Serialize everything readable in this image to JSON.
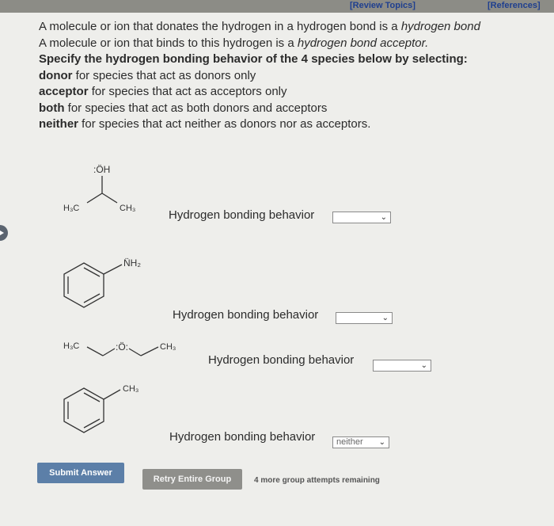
{
  "header": {
    "review_topics": "[Review Topics]",
    "references": "[References]"
  },
  "intro": {
    "line1_start": "A molecule or ion that donates the hydrogen in a hydrogen bond is a ",
    "line1_term": "hydrogen bond",
    "line2_start": "A molecule or ion that binds to this hydrogen is a ",
    "line2_term": "hydrogen bond acceptor.",
    "instruction": "Specify the hydrogen bonding behavior of the 4 species below by selecting:",
    "opt_donor_term": "donor",
    "opt_donor_rest": " for species that act as donors only",
    "opt_acceptor_term": "acceptor",
    "opt_acceptor_rest": " for species that act as acceptors only",
    "opt_both_term": "both",
    "opt_both_rest": " for species that act as both donors and acceptors",
    "opt_neither_term": "neither",
    "opt_neither_rest": " for species that act neither as donors nor as acceptors."
  },
  "species": [
    {
      "label": "Hydrogen bonding behavior",
      "selected": "",
      "atoms": {
        "oh": ":ÖH",
        "left": "H₃C",
        "right": "CH₃"
      }
    },
    {
      "label": "Hydrogen bonding behavior",
      "selected": "",
      "atoms": {
        "nh2": "N̈H₂"
      }
    },
    {
      "label": "Hydrogen bonding behavior",
      "selected": "",
      "atoms": {
        "left": "H₃C",
        "o": ":Ö:",
        "right": "CH₃"
      }
    },
    {
      "label": "Hydrogen bonding behavior",
      "selected": "neither",
      "atoms": {
        "ch3": "CH₃"
      }
    }
  ],
  "buttons": {
    "submit": "Submit Answer",
    "retry": "Retry Entire Group"
  },
  "attempts": "4 more group attempts remaining"
}
